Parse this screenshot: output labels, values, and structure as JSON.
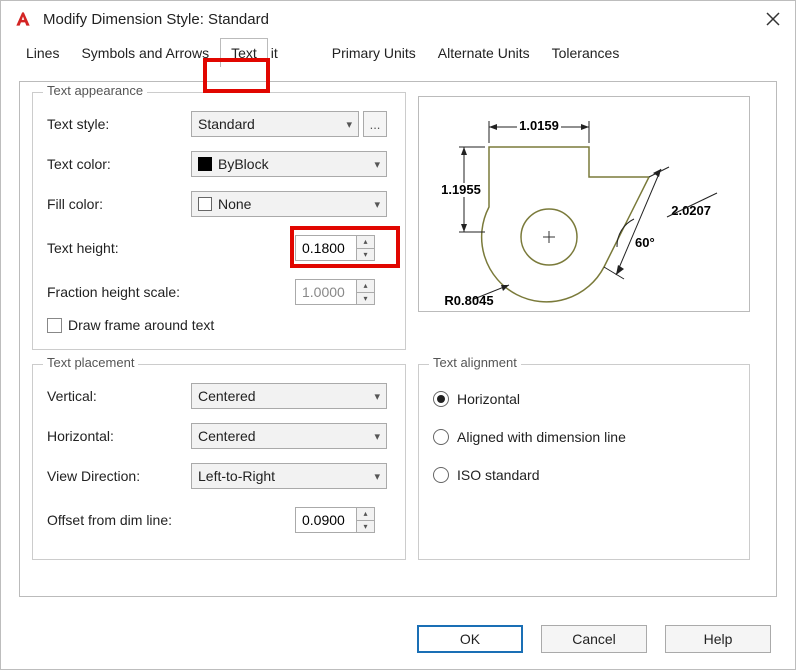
{
  "window": {
    "title": "Modify Dimension Style: Standard"
  },
  "tabs": {
    "items": [
      {
        "label": "Lines"
      },
      {
        "label": "Symbols and Arrows"
      },
      {
        "label": "Text"
      },
      {
        "label": "it"
      },
      {
        "label": "Primary Units"
      },
      {
        "label": "Alternate Units"
      },
      {
        "label": "Tolerances"
      }
    ],
    "active_index": 2
  },
  "appearance": {
    "legend": "Text appearance",
    "text_style_label": "Text style:",
    "text_style_value": "Standard",
    "text_color_label": "Text color:",
    "text_color_value": "ByBlock",
    "fill_color_label": "Fill color:",
    "fill_color_value": "None",
    "text_height_label": "Text height:",
    "text_height_value": "0.1800",
    "fraction_scale_label": "Fraction height scale:",
    "fraction_scale_value": "1.0000",
    "draw_frame_label": "Draw frame around text",
    "draw_frame_checked": false
  },
  "placement": {
    "legend": "Text placement",
    "vertical_label": "Vertical:",
    "vertical_value": "Centered",
    "horizontal_label": "Horizontal:",
    "horizontal_value": "Centered",
    "view_dir_label": "View Direction:",
    "view_dir_value": "Left-to-Right",
    "offset_label": "Offset from dim line:",
    "offset_value": "0.0900"
  },
  "alignment": {
    "legend": "Text alignment",
    "options": [
      {
        "label": "Horizontal",
        "checked": true
      },
      {
        "label": "Aligned with dimension line",
        "checked": false
      },
      {
        "label": "ISO standard",
        "checked": false
      }
    ]
  },
  "preview_dims": {
    "top": "1.0159",
    "left": "1.1955",
    "diag": "2.0207",
    "angle": "60°",
    "radius": "R0.8045"
  },
  "buttons": {
    "ok": "OK",
    "cancel": "Cancel",
    "help": "Help"
  }
}
